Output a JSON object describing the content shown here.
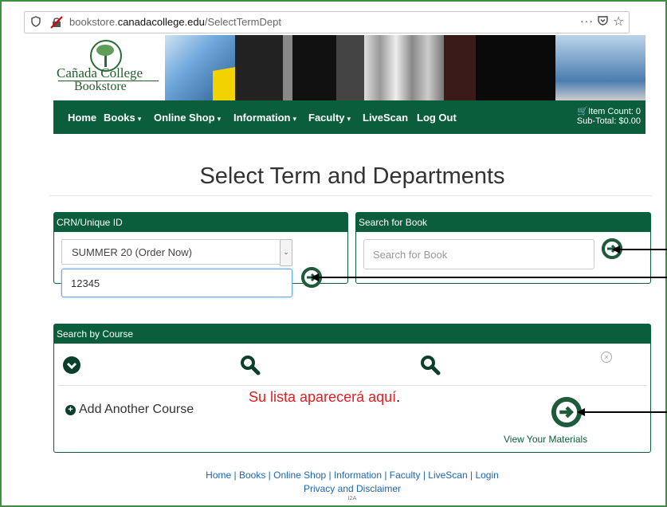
{
  "browser": {
    "url_prefix": "bookstore.",
    "url_domain": "canadacollege.edu",
    "url_path": "/SelectTermDept",
    "menu_glyph": "···"
  },
  "logo": {
    "line1": "Cañada College",
    "line2": "Bookstore"
  },
  "nav": {
    "items": [
      {
        "label": "Home",
        "caret": false
      },
      {
        "label": "Books",
        "caret": true
      },
      {
        "label": "Online Shop",
        "caret": true
      },
      {
        "label": "Information",
        "caret": true
      },
      {
        "label": "Faculty",
        "caret": true
      },
      {
        "label": "LiveScan",
        "caret": false
      },
      {
        "label": "Log Out",
        "caret": false
      }
    ],
    "cart_count": "Item Count: 0",
    "cart_subtotal": "Sub-Total: $0.00"
  },
  "page_title": "Select Term and Departments",
  "crn_panel": {
    "header": "CRN/Unique ID",
    "term_selected": "SUMMER 20 (Order Now)",
    "crn_value": "12345"
  },
  "book_panel": {
    "header": "Search for Book",
    "placeholder": "Search for Book"
  },
  "course_panel": {
    "header": "Search by Course",
    "add_course": "Add Another Course",
    "list_message": "Su lista aparecerá aquí",
    "list_message_dot": ".",
    "view_materials": "View Your Materials"
  },
  "footer": {
    "links": [
      "Home",
      "Books",
      "Online Shop",
      "Information",
      "Faculty",
      "LiveScan",
      "Login"
    ],
    "privacy": "Privacy and Disclaimer",
    "tiny": "I2A"
  },
  "colors": {
    "brand_green": "#0b5e3b",
    "dark_green": "#0b3f2c",
    "annotation_red": "#e02020"
  }
}
